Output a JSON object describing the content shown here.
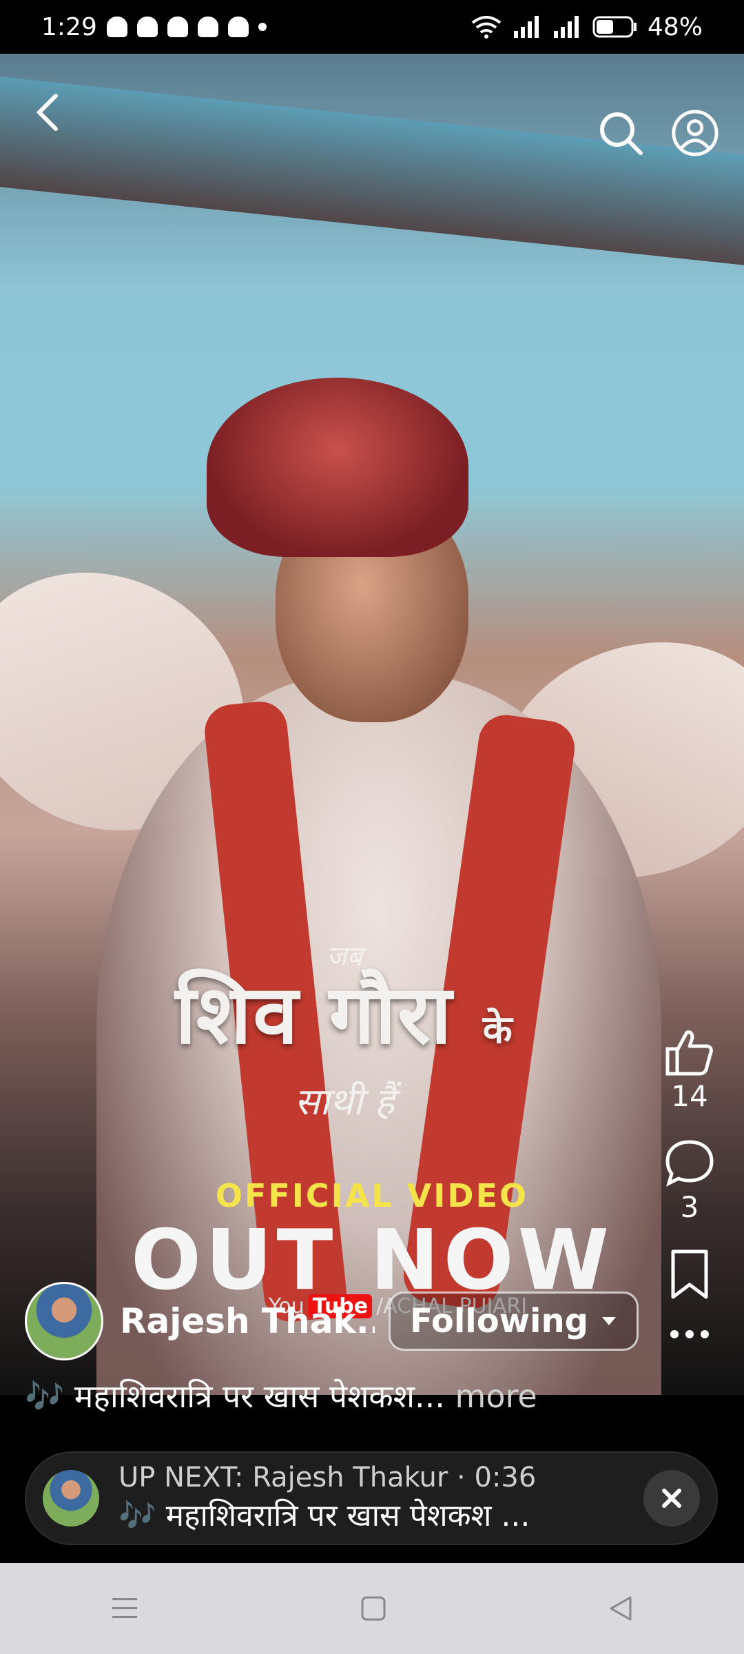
{
  "status_bar": {
    "time": "1:29",
    "battery": "48%"
  },
  "video": {
    "overlay_title_top": "जब",
    "overlay_title_main": "शिव गौरा",
    "overlay_title_side": "के",
    "overlay_title_sub": "साथी हैं",
    "official_label": "OFFICIAL VIDEO",
    "out_now_label": "OUT NOW",
    "credit_text": "/ACHAL PUJARI",
    "credit_you": "You",
    "credit_tube": "Tube"
  },
  "actions": {
    "likes": "14",
    "comments": "3"
  },
  "author": {
    "name": "Rajesh Thak...",
    "follow_label": "Following"
  },
  "caption": {
    "text": "🎶 महाशिवरात्रि पर खास पेशकश...",
    "more": "more"
  },
  "up_next": {
    "line1": "UP NEXT: Rajesh Thakur · 0:36",
    "line2": "🎶 महाशिवरात्रि पर खास पेशकश ..."
  },
  "icons": [
    "back-icon",
    "search-icon",
    "profile-icon",
    "like-icon",
    "comment-icon",
    "bookmark-icon",
    "more-icon",
    "close-icon",
    "menu-icon",
    "home-icon",
    "back-nav-icon"
  ]
}
